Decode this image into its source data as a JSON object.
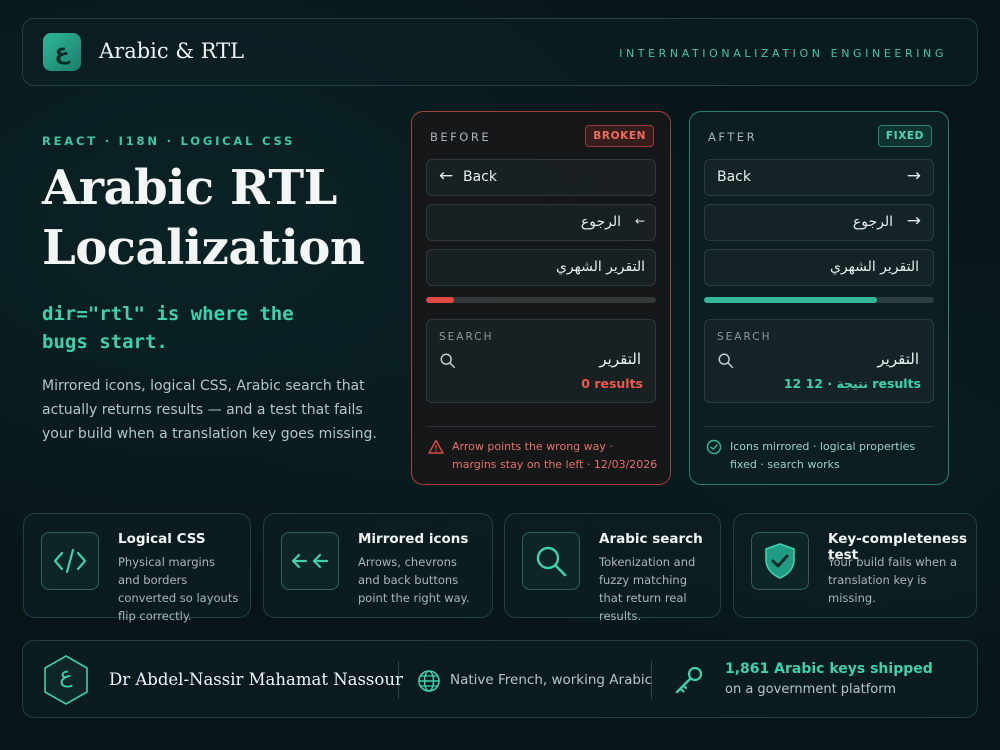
{
  "header": {
    "logo_glyph": "ع",
    "brand": "Arabic & RTL",
    "tagline": "INTERNATIONALIZATION ENGINEERING"
  },
  "hero": {
    "eyebrow": "REACT · I18N · LOGICAL CSS",
    "title": "Arabic RTL Localization",
    "code": "dir=\"rtl\" is where the bugs start.",
    "body": "Mirrored icons, logical CSS, Arabic search that actually returns results — and a test that fails your build when a translation key goes missing."
  },
  "before": {
    "label": "BEFORE",
    "badge": "BROKEN",
    "back": "Back",
    "back_ar": "الرجوع",
    "report": "التقرير الشهري",
    "progress": 0.12,
    "search_label": "SEARCH",
    "query": "التقرير",
    "results": "0 results",
    "note": "Arrow points the wrong way · margins stay on the left · 12/03/2026",
    "colors": {
      "accent": "#e04a44"
    }
  },
  "after": {
    "label": "AFTER",
    "badge": "FIXED",
    "back": "Back",
    "back_ar": "الرجوع",
    "report": "التقرير الشهري",
    "progress": 0.75,
    "search_label": "SEARCH",
    "query": "التقرير",
    "results": "12 نتيجة · 12 results",
    "note": "Icons mirrored · logical properties fixed · search works",
    "colors": {
      "accent": "#34b99b"
    }
  },
  "features": [
    {
      "icon": "code-icon",
      "title": "Logical CSS",
      "desc": "Physical margins and borders converted so layouts flip correctly."
    },
    {
      "icon": "mirror-arrows-icon",
      "title": "Mirrored icons",
      "desc": "Arrows, chevrons and back buttons point the right way."
    },
    {
      "icon": "search-icon",
      "title": "Arabic search",
      "desc": "Tokenization and fuzzy matching that return real results."
    },
    {
      "icon": "shield-check-icon",
      "title": "Key-completeness test",
      "desc": "Your build fails when a translation key is missing."
    }
  ],
  "footer": {
    "author_glyph": "ع",
    "author": "Dr Abdel-Nassir Mahamat Nassour",
    "languages": "Native French, working Arabic",
    "keys_count": "1,861 Arabic keys shipped",
    "keys_sub": "on a government platform"
  },
  "theme": {
    "accent": "#3fd0ae",
    "background": "#071418",
    "broken": "#e04a44"
  }
}
